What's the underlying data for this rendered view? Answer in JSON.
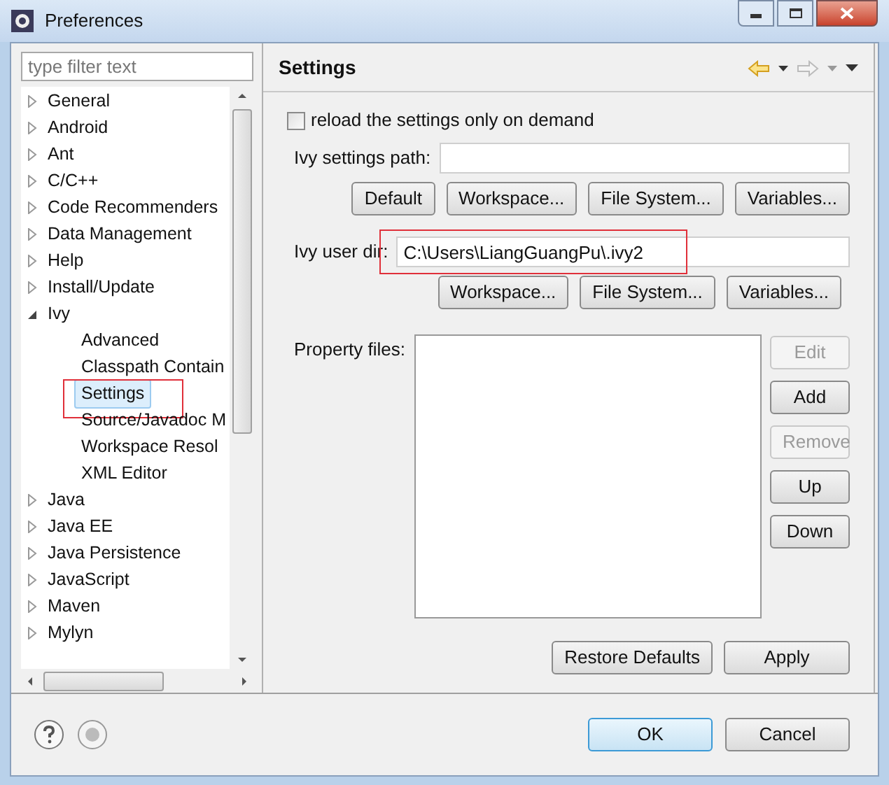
{
  "window": {
    "title": "Preferences"
  },
  "filter": {
    "placeholder": "type filter text"
  },
  "tree": [
    {
      "label": "General",
      "expanded": false
    },
    {
      "label": "Android",
      "expanded": false
    },
    {
      "label": "Ant",
      "expanded": false
    },
    {
      "label": "C/C++",
      "expanded": false
    },
    {
      "label": "Code Recommenders",
      "expanded": false
    },
    {
      "label": "Data Management",
      "expanded": false
    },
    {
      "label": "Help",
      "expanded": false
    },
    {
      "label": "Install/Update",
      "expanded": false
    },
    {
      "label": "Ivy",
      "expanded": true,
      "children": [
        {
          "label": "Advanced",
          "selected": false
        },
        {
          "label": "Classpath Contain",
          "selected": false
        },
        {
          "label": "Settings",
          "selected": true,
          "annotated": true
        },
        {
          "label": "Source/Javadoc M",
          "selected": false
        },
        {
          "label": "Workspace Resol",
          "selected": false
        },
        {
          "label": "XML Editor",
          "selected": false
        }
      ]
    },
    {
      "label": "Java",
      "expanded": false
    },
    {
      "label": "Java EE",
      "expanded": false
    },
    {
      "label": "Java Persistence",
      "expanded": false
    },
    {
      "label": "JavaScript",
      "expanded": false
    },
    {
      "label": "Maven",
      "expanded": false
    },
    {
      "label": "Mylyn",
      "expanded": false
    }
  ],
  "page": {
    "title": "Settings",
    "reload_checkbox": {
      "label": "reload the settings only on demand",
      "checked": false
    },
    "settings_path": {
      "label": "Ivy settings path:",
      "buttons": [
        {
          "label": "Default",
          "disabled": false
        },
        {
          "label": "Workspace...",
          "disabled": false
        },
        {
          "label": "File System...",
          "disabled": false
        },
        {
          "label": "Variables...",
          "disabled": false
        }
      ]
    },
    "user_dir": {
      "label": "Ivy user dir:",
      "value": "C:\\Users\\LiangGuangPu\\.ivy2",
      "annotated": true,
      "buttons": [
        {
          "label": "Workspace...",
          "disabled": false
        },
        {
          "label": "File System...",
          "disabled": false
        },
        {
          "label": "Variables...",
          "disabled": false
        }
      ]
    },
    "property_files": {
      "label": "Property files:",
      "buttons": [
        {
          "label": "Edit",
          "disabled": true
        },
        {
          "label": "Add",
          "disabled": false
        },
        {
          "label": "Remove",
          "disabled": true
        },
        {
          "label": "Up",
          "disabled": false
        },
        {
          "label": "Down",
          "disabled": false
        }
      ]
    },
    "actions": [
      {
        "label": "Restore Defaults",
        "default": false
      },
      {
        "label": "Apply",
        "default": false
      }
    ]
  },
  "footer": {
    "buttons": [
      {
        "label": "OK",
        "default": true
      },
      {
        "label": "Cancel",
        "default": false
      }
    ]
  }
}
